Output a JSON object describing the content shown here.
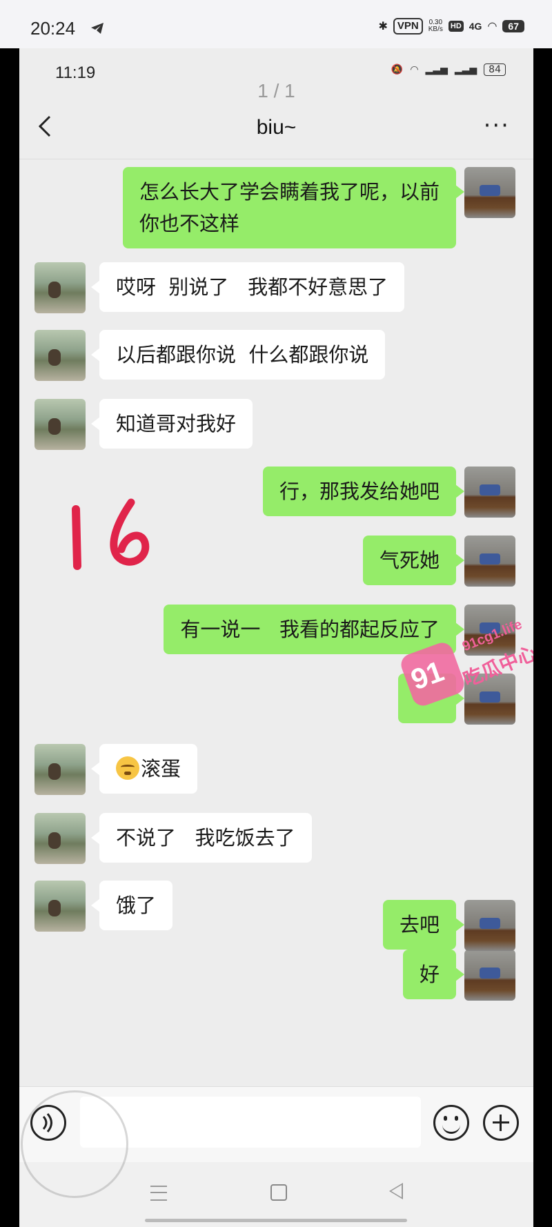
{
  "outer_status": {
    "time": "20:24",
    "vpn": "VPN",
    "speed_value": "0.30",
    "speed_unit": "KB/s",
    "hd": "HD",
    "network": "4G",
    "battery": "67"
  },
  "inner_status": {
    "time": "11:19",
    "battery": "84"
  },
  "page_indicator": "1 / 1",
  "chat": {
    "title": "biu~",
    "back_icon": "chevron-left-icon",
    "more_label": "···"
  },
  "messages": [
    {
      "from": "me",
      "text": "怎么长大了学会瞒着我了呢，以前\n你也不这样"
    },
    {
      "from": "her",
      "text": "哎呀  别说了   我都不好意思了"
    },
    {
      "from": "her",
      "text": "以后都跟你说  什么都跟你说"
    },
    {
      "from": "her",
      "text": "知道哥对我好"
    },
    {
      "from": "me",
      "text": "行，那我发给她吧"
    },
    {
      "from": "me",
      "text": "气死她"
    },
    {
      "from": "me",
      "text": "有一说一   我看的都起反应了"
    },
    {
      "from": "me",
      "text": ""
    },
    {
      "from": "her",
      "text": "滚蛋",
      "emoji": "sweat-smile-emoji"
    },
    {
      "from": "her",
      "text": "不说了   我吃饭去了"
    },
    {
      "from": "her",
      "text": "饿了"
    },
    {
      "from": "me",
      "text": "好"
    },
    {
      "from": "me",
      "text": "去吧"
    }
  ],
  "watermark": {
    "number": "91",
    "site": "91cg1.life",
    "text": "吃瓜中心"
  },
  "input_bar": {
    "voice_icon": "voice-icon",
    "emoji_icon": "emoji-icon",
    "plus_icon": "plus-icon"
  },
  "colors": {
    "my_bubble": "#95ec69",
    "her_bubble": "#ffffff",
    "background": "#ededed",
    "watermark": "#f0609a"
  }
}
